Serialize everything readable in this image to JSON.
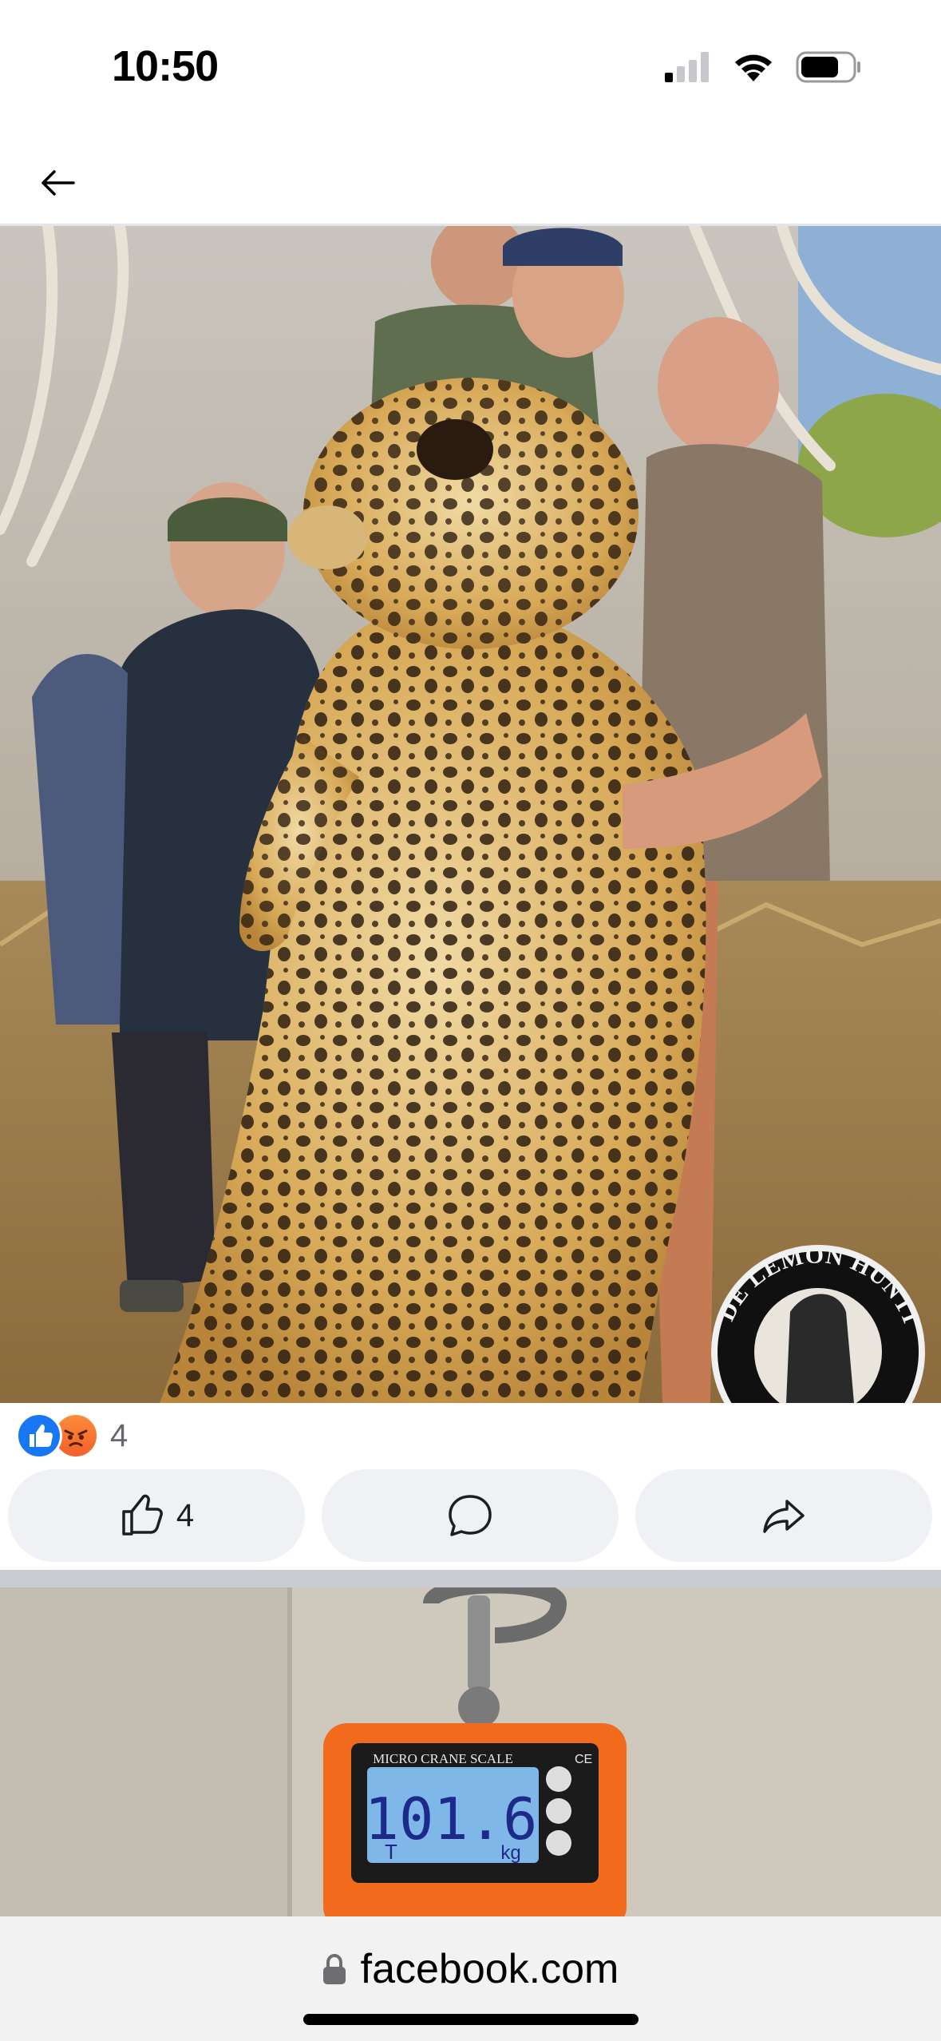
{
  "status_bar": {
    "time": "10:50"
  },
  "post": {
    "watermark": "WADE LEMON HUNTING",
    "reactions": {
      "count": "4"
    },
    "actions": {
      "like_count": "4"
    }
  },
  "next_post": {
    "scale_brand": "MICRO CRANE SCALE",
    "scale_reading": "101.6",
    "scale_left_mark": "T",
    "scale_unit": "kg",
    "scale_ce": "CE"
  },
  "browser": {
    "url": "facebook.com"
  },
  "colors": {
    "like_blue": "#1877f2",
    "angry_orange": "#f2612a",
    "scale_orange": "#f26a1b"
  }
}
